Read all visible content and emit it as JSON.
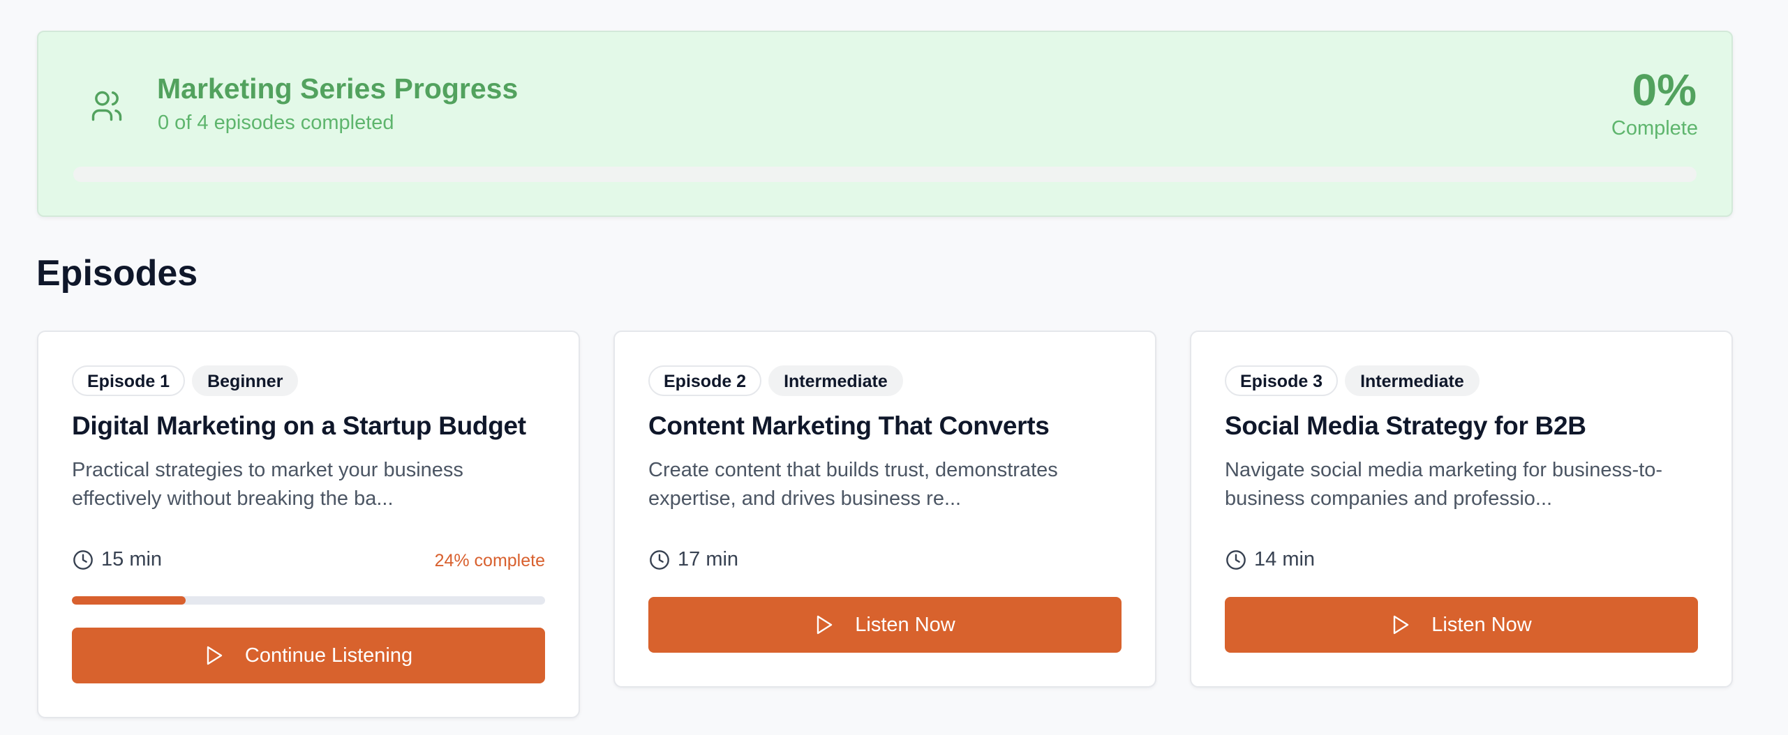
{
  "series_progress": {
    "icon": "users-icon",
    "title": "Marketing Series Progress",
    "subtitle": "0 of 4 episodes completed",
    "percent": "0%",
    "percent_label": "Complete",
    "progress_fraction": 0
  },
  "episodes_section": {
    "heading": "Episodes"
  },
  "episodes": [
    {
      "number_badge": "Episode 1",
      "level_badge": "Beginner",
      "title": "Digital Marketing on a Startup Budget",
      "description": "Practical strategies to market your business effectively without breaking the ba...",
      "duration": "15 min",
      "progress_text": "24% complete",
      "progress_fraction": 0.24,
      "button_label": "Continue Listening"
    },
    {
      "number_badge": "Episode 2",
      "level_badge": "Intermediate",
      "title": "Content Marketing That Converts",
      "description": "Create content that builds trust, demonstrates expertise, and drives business re...",
      "duration": "17 min",
      "button_label": "Listen Now"
    },
    {
      "number_badge": "Episode 3",
      "level_badge": "Intermediate",
      "title": "Social Media Strategy for B2B",
      "description": "Navigate social media marketing for business-to-business companies and professio...",
      "duration": "14 min",
      "button_label": "Listen Now"
    }
  ],
  "colors": {
    "accent": "#d8622d",
    "success": "#52a25e",
    "panel_bg": "#e3f9e8",
    "page_bg": "#f8f9fb"
  },
  "icons": {
    "duration": "clock-icon",
    "button": "play-icon"
  }
}
